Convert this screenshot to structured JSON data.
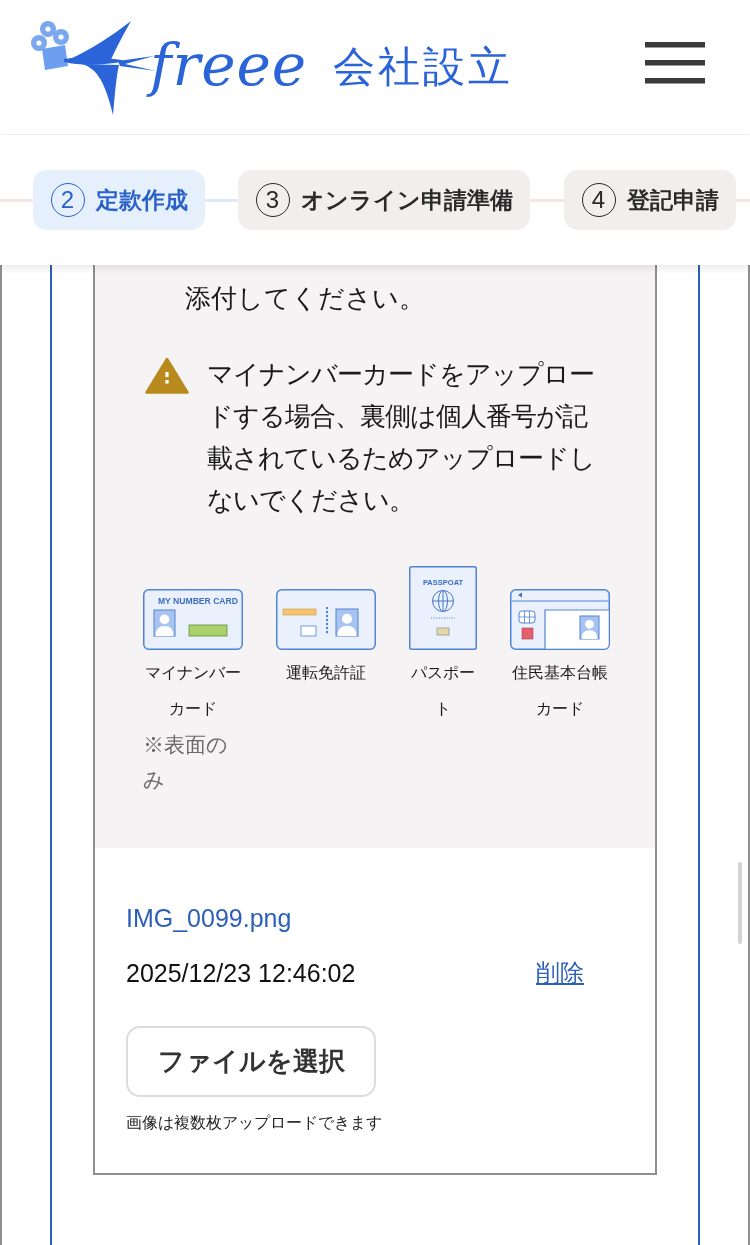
{
  "header": {
    "logo": {
      "wordmark": "freee",
      "product": "会社設立"
    }
  },
  "steps": [
    {
      "number": "2",
      "label": "定款作成",
      "selected": true
    },
    {
      "number": "3",
      "label": "オンライン申請準備",
      "selected": false
    },
    {
      "number": "4",
      "label": "登記申請",
      "selected": false
    }
  ],
  "upload_panel": {
    "instruction_tail": "添付してください。",
    "warning": {
      "text": "マイナンバーカードをアップロードする場合、裏側は個人番号が記載されているためアップロードしないでください。"
    },
    "documents": [
      {
        "kind": "my_number_card",
        "icon_text": "MY NUMBER CARD",
        "label": "マイナンバーカード",
        "note": "※表面のみ"
      },
      {
        "kind": "drivers_license",
        "label": "運転免許証"
      },
      {
        "kind": "passport",
        "icon_text": "PASSPOAT",
        "label": "パスポート"
      },
      {
        "kind": "resident_card",
        "label": "住民基本台帳カード"
      }
    ],
    "file": {
      "name": "IMG_0099.png",
      "timestamp": "2025/12/23 12:46:02",
      "delete_link": "削除"
    },
    "select_button": "ファイルを選択",
    "hint": "画像は複数枚アップロードできます"
  }
}
